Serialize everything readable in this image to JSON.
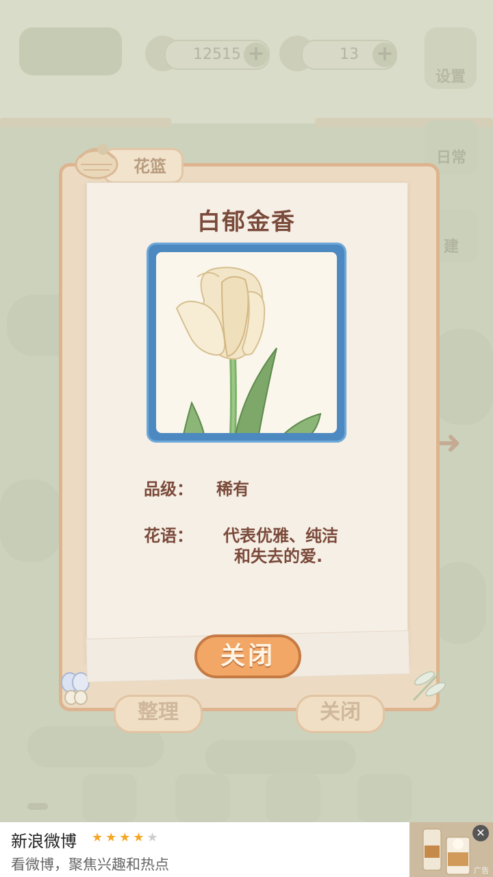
{
  "hud": {
    "coins": "12515",
    "cheese": "13",
    "settings_label": "设置",
    "plus_symbol": "+"
  },
  "side": {
    "daily_label": "日常",
    "build_label": "建"
  },
  "basket": {
    "tab_label": "花篮",
    "sort_label": "整理",
    "close_label": "关闭"
  },
  "card": {
    "name": "白郁金香",
    "grade_label": "品级：",
    "grade_value": "稀有",
    "language_label": "花语：",
    "language_line1": "代表优雅、纯洁",
    "language_line2": "和失去的爱.",
    "close_label": "关闭"
  },
  "ad": {
    "title": "新浪微博",
    "rating": 4,
    "stars_on": "★★★★",
    "stars_off": "★",
    "description": "看微博，聚焦兴趣和热点",
    "tag": "广告",
    "close_symbol": "✕"
  },
  "colors": {
    "frame_blue": "#4d89c1",
    "button_orange": "#f2a767",
    "text_brown": "#7a4a3a"
  }
}
